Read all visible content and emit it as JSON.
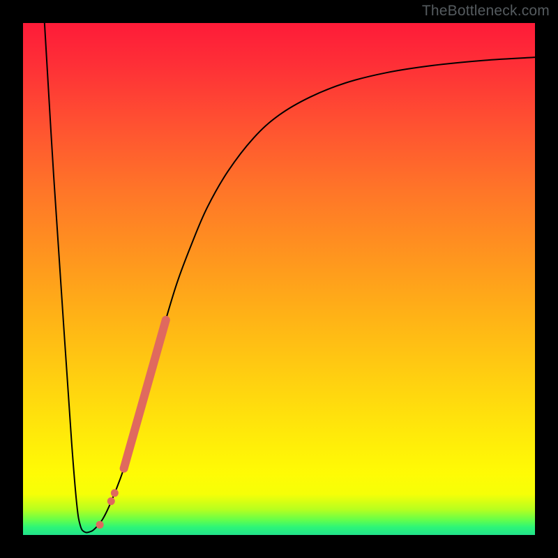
{
  "watermark": "TheBottleneck.com",
  "chart_data": {
    "type": "line",
    "title": "",
    "xlabel": "",
    "ylabel": "",
    "xlim": [
      0,
      100
    ],
    "ylim": [
      0,
      100
    ],
    "grid": false,
    "legend": false,
    "note": "Axes are unlabeled; x/y expressed as percent of plot width/height with (0,0) at bottom-left. Values are estimated from pixels.",
    "series": [
      {
        "name": "main-curve",
        "color": "#000000",
        "stroke_width": 2,
        "points": [
          {
            "x": 4.2,
            "y": 100.0
          },
          {
            "x": 6.0,
            "y": 70.0
          },
          {
            "x": 8.0,
            "y": 40.0
          },
          {
            "x": 9.5,
            "y": 18.0
          },
          {
            "x": 10.5,
            "y": 6.0
          },
          {
            "x": 11.2,
            "y": 1.8
          },
          {
            "x": 12.0,
            "y": 0.6
          },
          {
            "x": 13.0,
            "y": 0.6
          },
          {
            "x": 14.0,
            "y": 1.2
          },
          {
            "x": 15.5,
            "y": 3.0
          },
          {
            "x": 17.0,
            "y": 6.0
          },
          {
            "x": 19.0,
            "y": 11.0
          },
          {
            "x": 21.0,
            "y": 17.0
          },
          {
            "x": 23.0,
            "y": 24.0
          },
          {
            "x": 25.0,
            "y": 32.0
          },
          {
            "x": 27.0,
            "y": 39.0
          },
          {
            "x": 30.0,
            "y": 49.0
          },
          {
            "x": 33.0,
            "y": 57.0
          },
          {
            "x": 36.0,
            "y": 64.0
          },
          {
            "x": 40.0,
            "y": 71.0
          },
          {
            "x": 45.0,
            "y": 77.5
          },
          {
            "x": 50.0,
            "y": 82.0
          },
          {
            "x": 56.0,
            "y": 85.5
          },
          {
            "x": 63.0,
            "y": 88.3
          },
          {
            "x": 71.0,
            "y": 90.3
          },
          {
            "x": 80.0,
            "y": 91.7
          },
          {
            "x": 90.0,
            "y": 92.7
          },
          {
            "x": 100.0,
            "y": 93.3
          }
        ]
      },
      {
        "name": "highlight-segment",
        "color": "#e0695e",
        "stroke_width": 12,
        "linecap": "round",
        "points": [
          {
            "x": 19.7,
            "y": 13.0
          },
          {
            "x": 27.9,
            "y": 42.0
          }
        ]
      }
    ],
    "dots": {
      "name": "highlight-dots",
      "color": "#e0695e",
      "radius": 5.5,
      "points": [
        {
          "x": 17.2,
          "y": 6.6
        },
        {
          "x": 17.9,
          "y": 8.2
        },
        {
          "x": 15.0,
          "y": 2.0
        }
      ]
    }
  }
}
